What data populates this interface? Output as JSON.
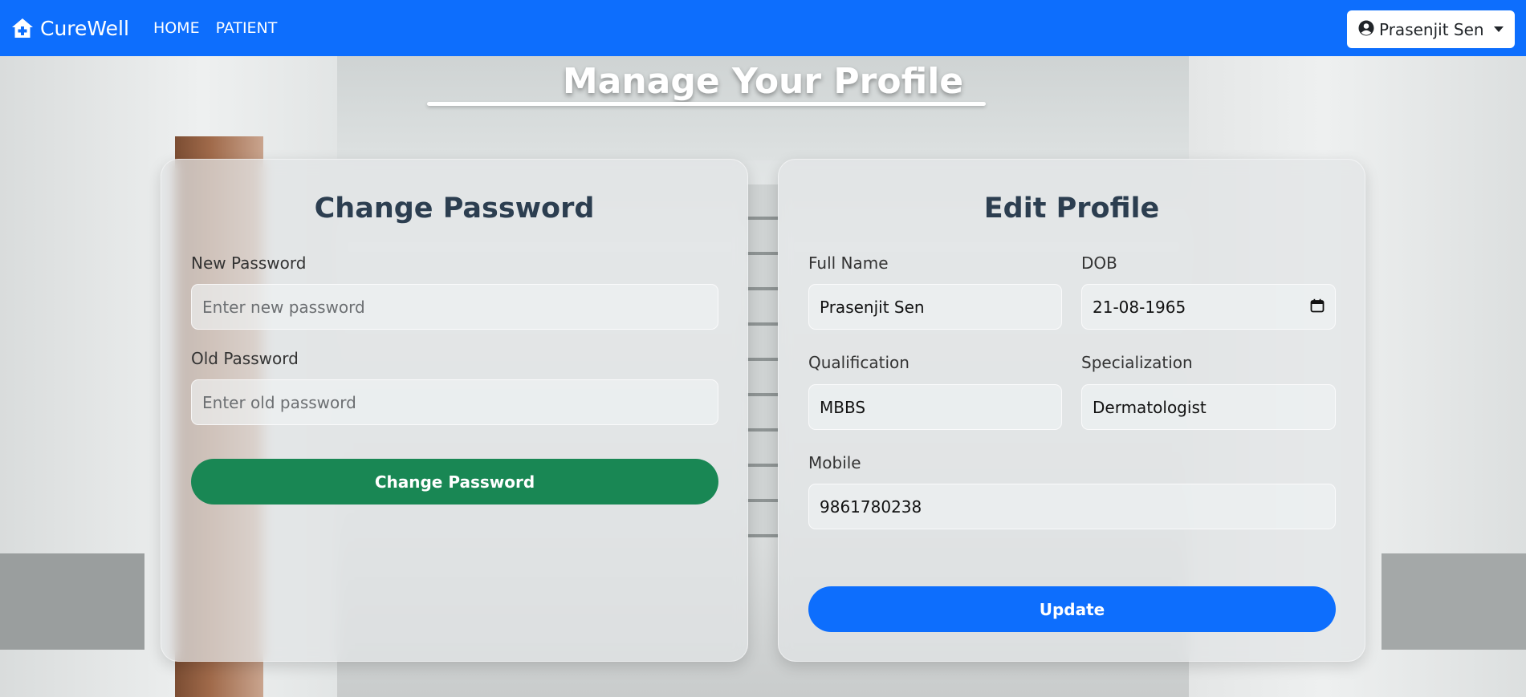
{
  "navbar": {
    "brand": "CureWell",
    "links": [
      "HOME",
      "PATIENT"
    ],
    "user_name": "Prasenjit Sen"
  },
  "page": {
    "title": "Manage Your Profile"
  },
  "change_password": {
    "title": "Change Password",
    "new_password_label": "New Password",
    "new_password_placeholder": "Enter new password",
    "old_password_label": "Old Password",
    "old_password_placeholder": "Enter old password",
    "submit_label": "Change Password"
  },
  "edit_profile": {
    "title": "Edit Profile",
    "full_name_label": "Full Name",
    "full_name_value": "Prasenjit Sen",
    "dob_label": "DOB",
    "dob_value": "21-08-1965",
    "qualification_label": "Qualification",
    "qualification_value": "MBBS",
    "specialization_label": "Specialization",
    "specialization_value": "Dermatologist",
    "mobile_label": "Mobile",
    "mobile_value": "9861780238",
    "submit_label": "Update"
  },
  "colors": {
    "primary": "#0d6efd",
    "success": "#198754",
    "heading": "#2c3e50"
  },
  "icons": {
    "brand": "hospital-house-icon",
    "user": "user-circle-icon",
    "calendar": "calendar-icon"
  }
}
